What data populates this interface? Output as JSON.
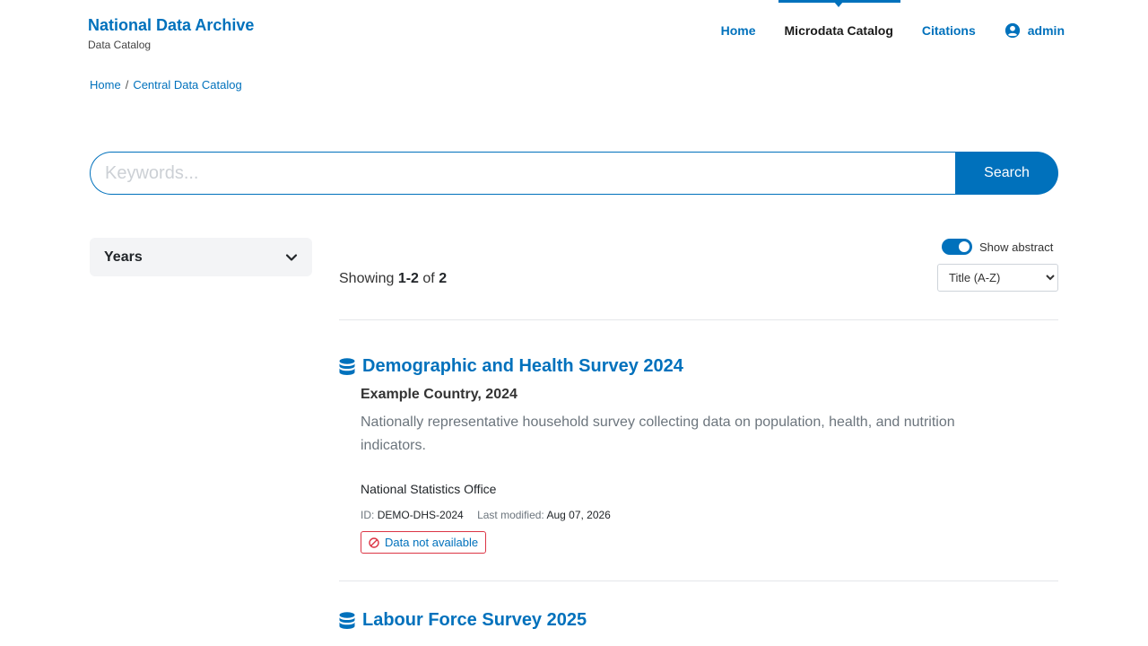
{
  "brand": {
    "title": "National Data Archive",
    "subtitle": "Data Catalog"
  },
  "nav": {
    "home": "Home",
    "catalog": "Microdata Catalog",
    "citations": "Citations",
    "user": "admin"
  },
  "breadcrumb": {
    "home": "Home",
    "separator": "/",
    "current": "Central Data Catalog"
  },
  "search": {
    "placeholder": "Keywords...",
    "button": "Search"
  },
  "facets": {
    "years_label": "Years"
  },
  "toolbar": {
    "show_abstract_label": "Show abstract",
    "show_abstract_on": true,
    "showing_prefix": "Showing",
    "showing_range": "1-2",
    "showing_of": "of",
    "showing_total": "2",
    "sort_selected": "Title (A-Z)"
  },
  "results": [
    {
      "title": "Demographic and Health Survey 2024",
      "subtitle": "Example Country, 2024",
      "abstract": "Nationally representative household survey collecting data on population, health, and nutrition indicators.",
      "organization": "National Statistics Office",
      "id_label": "ID:",
      "id_value": "DEMO-DHS-2024",
      "modified_label": "Last modified:",
      "modified_value": "Aug 07, 2026",
      "availability": "Data not available"
    },
    {
      "title": "Labour Force Survey 2025"
    }
  ],
  "colors": {
    "accent": "#0071bc",
    "danger": "#dc3545",
    "muted": "#6c757d"
  }
}
